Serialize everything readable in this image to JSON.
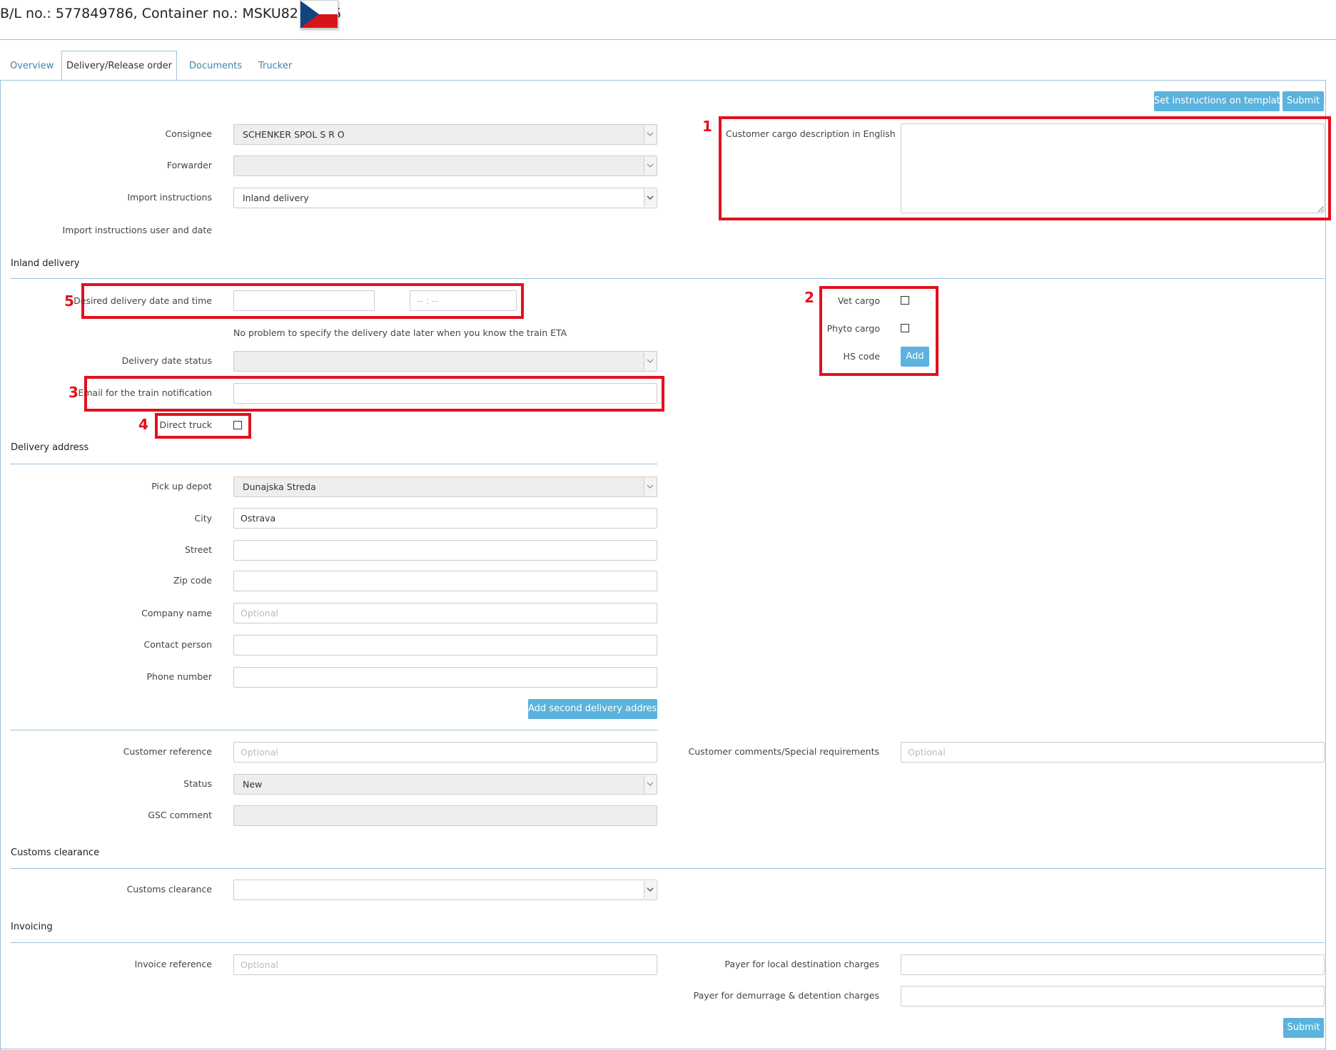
{
  "header": {
    "title": "B/L no.: 577849786, Container no.: MSKU8219855",
    "flag_icon": "czech-flag-icon",
    "flag_colors": {
      "white": "#ffffff",
      "red": "#d7141a",
      "blue": "#11457e"
    }
  },
  "tabs": [
    {
      "label": "Overview"
    },
    {
      "label": "Delivery/Release order"
    },
    {
      "label": "Documents"
    },
    {
      "label": "Trucker"
    }
  ],
  "actions": {
    "set_template": "Set instructions on template",
    "submit": "Submit",
    "submit_bottom": "Submit"
  },
  "general": {
    "consignee_label": "Consignee",
    "consignee_value": "SCHENKER SPOL S R O",
    "forwarder_label": "Forwarder",
    "forwarder_value": "",
    "import_instructions_label": "Import instructions",
    "import_instructions_value": "Inland delivery",
    "import_user_date_label": "Import instructions user and date",
    "cargo_description_label": "Customer cargo description in English",
    "cargo_description_value": ""
  },
  "inland": {
    "section_title": "Inland delivery",
    "desired_date_label": "Desired delivery date and time",
    "date_value": "",
    "time_placeholder": "-- : --",
    "hint": "No problem to specify the delivery date later when you know the train ETA",
    "delivery_status_label": "Delivery date status",
    "email_label": "Email for the train notification",
    "email_value": "",
    "direct_truck_label": "Direct truck",
    "vet_label": "Vet cargo",
    "phyto_label": "Phyto cargo",
    "hs_label": "HS code",
    "add_button": "Add"
  },
  "address": {
    "section_title": "Delivery address",
    "pickup_label": "Pick up depot",
    "pickup_value": "Dunajska Streda",
    "city_label": "City",
    "city_value": "Ostrava",
    "street_label": "Street",
    "zip_label": "Zip code",
    "company_label": "Company name",
    "company_placeholder": "Optional",
    "contact_label": "Contact person",
    "phone_label": "Phone number",
    "add_second_button": "Add second delivery address"
  },
  "reference": {
    "customer_ref_label": "Customer reference",
    "customer_ref_placeholder": "Optional",
    "comments_label": "Customer comments/Special requirements",
    "comments_placeholder": "Optional",
    "status_label": "Status",
    "status_value": "New",
    "gsc_label": "GSC comment"
  },
  "customs": {
    "section_title": "Customs clearance",
    "label": "Customs clearance",
    "value": ""
  },
  "invoicing": {
    "section_title": "Invoicing",
    "invoice_ref_label": "Invoice reference",
    "invoice_ref_placeholder": "Optional",
    "payer_local_label": "Payer for local destination charges",
    "payer_demurrage_label": "Payer for demurrage & detention charges"
  },
  "annotations": [
    "1",
    "2",
    "3",
    "4",
    "5"
  ],
  "colors": {
    "accent": "#5bb3dd",
    "highlight": "#e3101d",
    "border": "#9ec3d8",
    "link": "#3a87ad"
  }
}
